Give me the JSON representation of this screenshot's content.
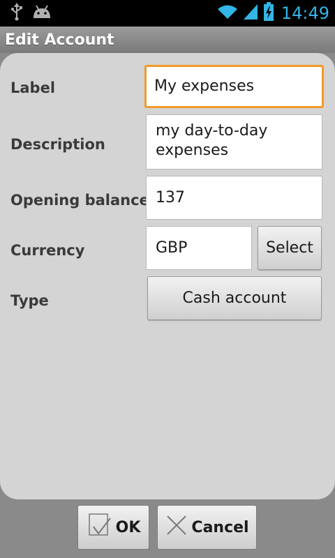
{
  "status_bar": {
    "time": "14:49",
    "icons": [
      "usb-icon",
      "android-debug-icon",
      "wifi-icon",
      "signal-icon",
      "battery-charging-icon"
    ],
    "accent_color": "#33b5e5"
  },
  "title_bar": {
    "title": "Edit Account"
  },
  "form": {
    "label": {
      "caption": "Label",
      "value": "My expenses"
    },
    "description": {
      "caption": "Description",
      "value": "my day-to-day expenses"
    },
    "opening_balance": {
      "caption": "Opening balance",
      "value": "137"
    },
    "currency": {
      "caption": "Currency",
      "value": "GBP",
      "select_label": "Select"
    },
    "type": {
      "caption": "Type",
      "value": "Cash account"
    }
  },
  "actions": {
    "ok_label": "OK",
    "cancel_label": "Cancel"
  },
  "colors": {
    "focus_border": "#f39a28",
    "panel_background": "#d4d4d4"
  }
}
